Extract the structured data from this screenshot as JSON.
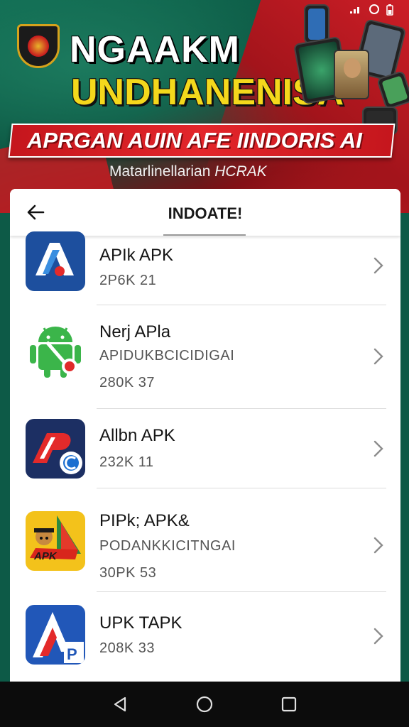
{
  "banner": {
    "title_line1": "NGAAKM",
    "title_line2": "UNDHANENISA",
    "ribbon": "APRGAN AUIN AFE IINDORIS AI",
    "subtitle_a": "Matarlinellarian ",
    "subtitle_b": "HCRAK",
    "colors": {
      "green": "#0e6b51",
      "red": "#d8212a",
      "yellow": "#f4d81c"
    }
  },
  "appbar": {
    "back_icon": "arrow-left-icon",
    "title": "INDOATE!"
  },
  "apps": [
    {
      "name": "APIk APK",
      "lines": [
        "2P6K  21"
      ],
      "icon": "blue-a-app-icon"
    },
    {
      "name": "Nerj APla",
      "lines": [
        "APIDUKBCICIDIGAI",
        "280K  37"
      ],
      "icon": "android-robot-icon"
    },
    {
      "name": "Allbn APK",
      "lines": [
        "232K  11"
      ],
      "icon": "red-p-app-icon"
    },
    {
      "name": "PIPk; APK&",
      "lines": [
        "PODANKKICITNGAI",
        "30PK  53"
      ],
      "icon": "yellow-mascot-app-icon"
    },
    {
      "name": "UPK TAPK",
      "lines": [
        "208K  33"
      ],
      "icon": "blue-arrow-app-icon"
    }
  ],
  "navbar": {
    "back": "nav-back-icon",
    "home": "nav-home-icon",
    "recents": "nav-recents-icon"
  }
}
